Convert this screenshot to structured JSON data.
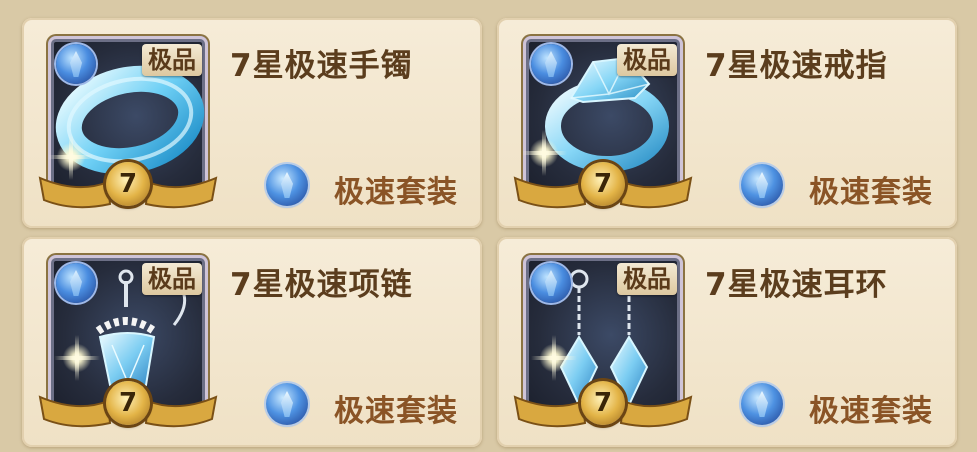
{
  "items": [
    {
      "name": "7星极速手镯",
      "quality": "极品",
      "stars": "7",
      "set_name": "极速套装",
      "art": "bracelet"
    },
    {
      "name": "7星极速戒指",
      "quality": "极品",
      "stars": "7",
      "set_name": "极速套装",
      "art": "ring"
    },
    {
      "name": "7星极速项链",
      "quality": "极品",
      "stars": "7",
      "set_name": "极速套装",
      "art": "necklace"
    },
    {
      "name": "7星极速耳环",
      "quality": "极品",
      "stars": "7",
      "set_name": "极速套装",
      "art": "earrings"
    }
  ],
  "colors": {
    "background": "#d9c9a6",
    "card": "#f6ecd8",
    "title_text": "#5b3d1d",
    "set_text": "#8a5426",
    "gem_blue": "#4a8de0",
    "gold": "#e3b447"
  },
  "icons": {
    "quality_gem": "blue-crystal-gem-icon",
    "set": "speed-set-gem-icon",
    "star_badge": "star-level-badge-icon"
  }
}
